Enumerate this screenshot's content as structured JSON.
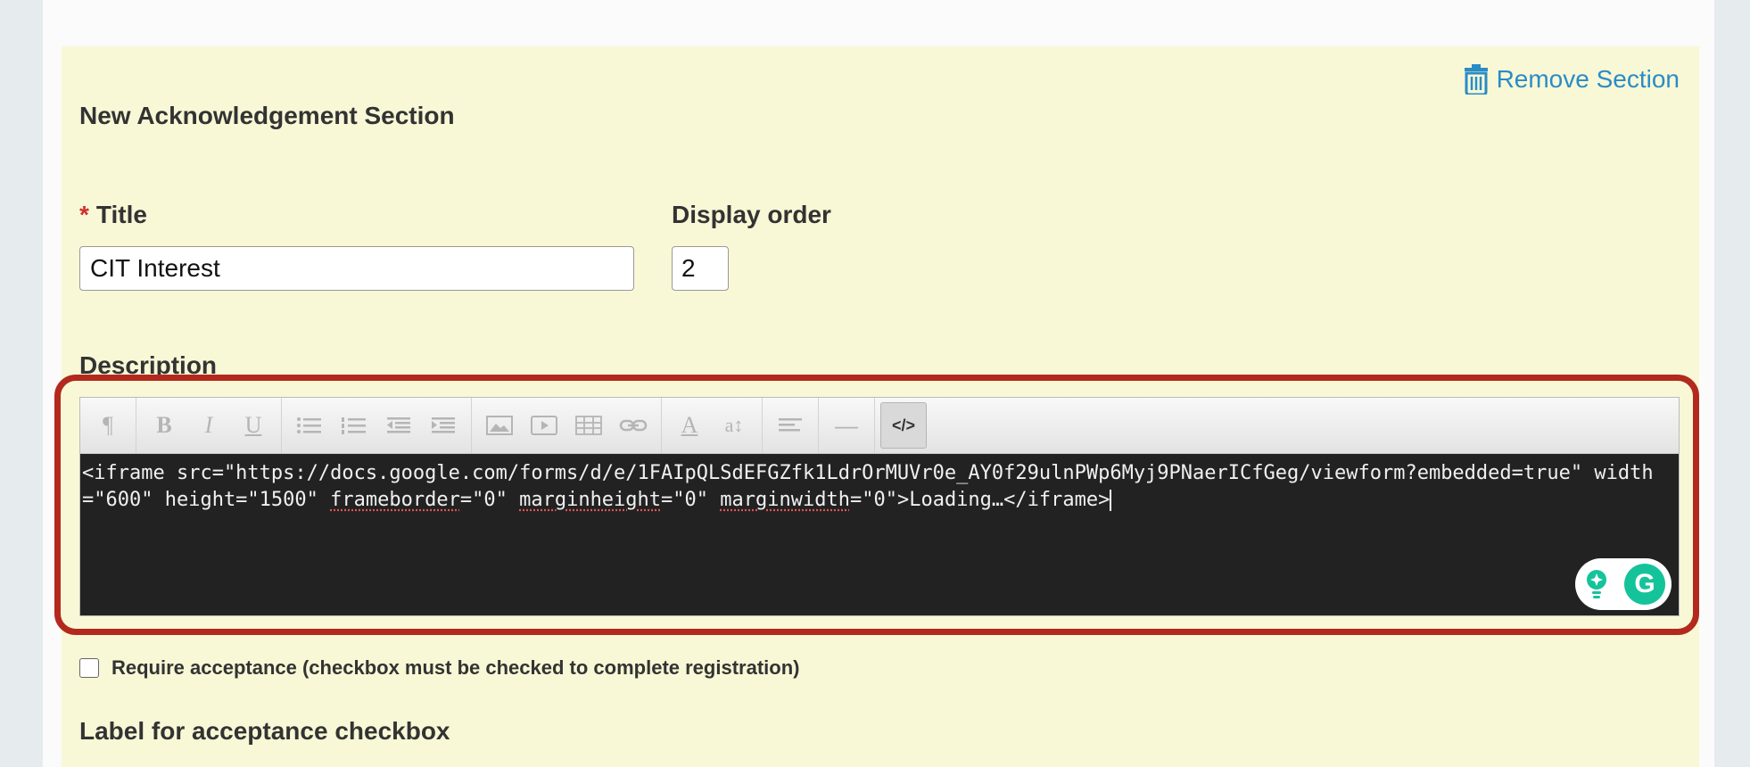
{
  "section": {
    "heading": "New Acknowledgement Section",
    "remove_label": "Remove Section"
  },
  "fields": {
    "title_label": "Title",
    "title_required_marker": "*",
    "title_value": "CIT Interest",
    "display_order_label": "Display order",
    "display_order_value": "2",
    "description_label": "Description"
  },
  "editor": {
    "toolbar": [
      {
        "name": "paragraph-format",
        "glyph": "¶"
      },
      {
        "name": "bold",
        "glyph": "B"
      },
      {
        "name": "italic",
        "glyph": "I"
      },
      {
        "name": "underline",
        "glyph": "U"
      },
      {
        "name": "unordered-list-icon"
      },
      {
        "name": "ordered-list-icon"
      },
      {
        "name": "outdent-icon"
      },
      {
        "name": "indent-icon"
      },
      {
        "name": "image-icon"
      },
      {
        "name": "video-icon"
      },
      {
        "name": "table-icon"
      },
      {
        "name": "link-icon"
      },
      {
        "name": "font-color-icon",
        "glyph": "A"
      },
      {
        "name": "font-size-icon",
        "glyph": "a↕"
      },
      {
        "name": "align-icon"
      },
      {
        "name": "horizontal-rule-icon",
        "glyph": "—"
      },
      {
        "name": "html-toggle",
        "glyph": "</>"
      }
    ],
    "code_segments": [
      {
        "text": "<iframe src=\"https://docs.google.com/forms/d/e/1FAIpQLSdEFGZfk1LdrOrMUVr0e_AY0f29ulnPWp6Myj9PNaerICfGeg/viewform?embedded=true\" width=\"600\" height=\"1500\" ",
        "spell": false
      },
      {
        "text": "frameborder",
        "spell": true
      },
      {
        "text": "=\"0\" ",
        "spell": false
      },
      {
        "text": "marginheight",
        "spell": true
      },
      {
        "text": "=\"0\" ",
        "spell": false
      },
      {
        "text": "marginwidth",
        "spell": true
      },
      {
        "text": "=\"0\">Loading…</iframe>",
        "spell": false
      }
    ],
    "grammarly_letter": "G"
  },
  "acceptance": {
    "checkbox_label": "Require acceptance (checkbox must be checked to complete registration)",
    "checked": false,
    "label_heading": "Label for acceptance checkbox"
  },
  "colors": {
    "link": "#2a8cc7",
    "highlight_border": "#b3291e",
    "section_bg": "#f8f8d6",
    "required": "#d0312d",
    "editor_bg": "#222222"
  }
}
